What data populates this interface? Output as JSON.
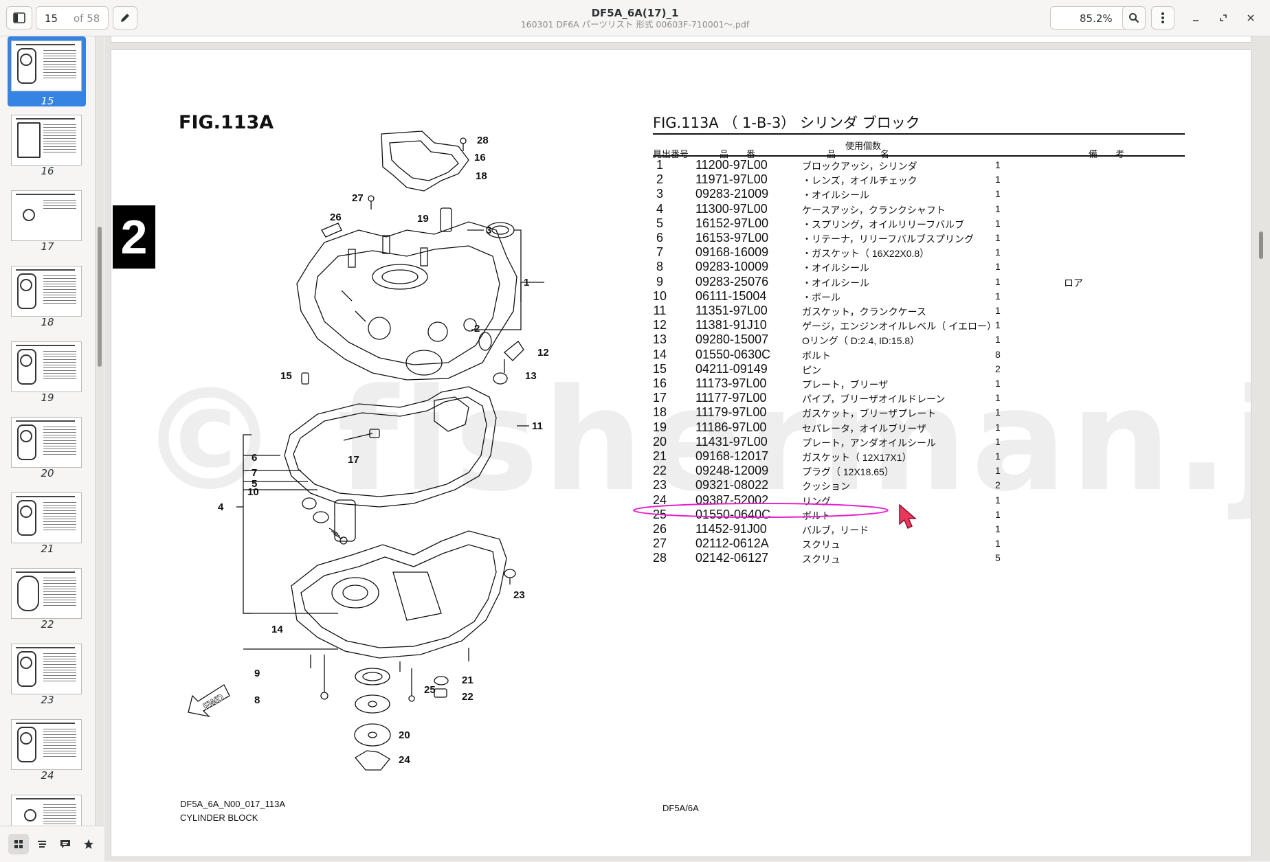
{
  "header": {
    "page_current": "15",
    "page_total": "of 58",
    "title": "DF5A_6A(17)_1",
    "subtitle": "160301 DF6A パーツリスト 形式 00603F-710001～.pdf",
    "zoom": "85.2%",
    "icons": [
      "sidebar-toggle-icon",
      "pencil-icon",
      "search-icon",
      "kebab-menu-icon",
      "minimize-icon",
      "maximize-icon",
      "close-icon"
    ]
  },
  "sidebar": {
    "thumbnails": [
      {
        "label": "15",
        "selected": true
      },
      {
        "label": "16"
      },
      {
        "label": "17"
      },
      {
        "label": "18"
      },
      {
        "label": "19"
      },
      {
        "label": "20"
      },
      {
        "label": "21"
      },
      {
        "label": "22"
      },
      {
        "label": "23"
      },
      {
        "label": "24"
      }
    ],
    "bottom_icons": [
      "thumbnails-icon",
      "outline-icon",
      "annotations-icon",
      "bookmarks-icon"
    ]
  },
  "document": {
    "fig_label": "FIG.113A",
    "section_number": "2",
    "watermark": "© fisherman.jp",
    "table": {
      "title": "FIG.113A （ 1-B-3） シリンダ ブロック",
      "headers": {
        "ref": "見出番号",
        "part_no": "品　　番",
        "name": "品　　　　　名",
        "qty": "使用個数",
        "remarks": "備　　考"
      },
      "rows": [
        {
          "no": "1",
          "part": "11200-97L00",
          "desc": "ブロックアッシ，シリンダ",
          "qty": "1",
          "rem": ""
        },
        {
          "no": "2",
          "part": "11971-97L00",
          "desc": "・レンズ，オイルチェック",
          "qty": "1",
          "rem": ""
        },
        {
          "no": "3",
          "part": "09283-21009",
          "desc": "・オイルシール",
          "qty": "1",
          "rem": ""
        },
        {
          "no": "4",
          "part": "11300-97L00",
          "desc": "ケースアッシ，クランクシャフト",
          "qty": "1",
          "rem": ""
        },
        {
          "no": "5",
          "part": "16152-97L00",
          "desc": "・スプリング，オイルリリーフバルブ",
          "qty": "1",
          "rem": ""
        },
        {
          "no": "6",
          "part": "16153-97L00",
          "desc": "・リテーナ，リリーフバルブスプリング",
          "qty": "1",
          "rem": ""
        },
        {
          "no": "7",
          "part": "09168-16009",
          "desc": "・ガスケット（ 16X22X0.8）",
          "qty": "1",
          "rem": ""
        },
        {
          "no": "8",
          "part": "09283-10009",
          "desc": "・オイルシール",
          "qty": "1",
          "rem": ""
        },
        {
          "no": "9",
          "part": "09283-25076",
          "desc": "・オイルシール",
          "qty": "1",
          "rem": "ロア"
        },
        {
          "no": "10",
          "part": "06111-15004",
          "desc": "・ボール",
          "qty": "1",
          "rem": ""
        },
        {
          "no": "11",
          "part": "11351-97L00",
          "desc": "ガスケット，クランクケース",
          "qty": "1",
          "rem": ""
        },
        {
          "no": "12",
          "part": "11381-91J10",
          "desc": "ゲージ，エンジンオイルレベル（ イエロー）",
          "qty": "1",
          "rem": ""
        },
        {
          "no": "13",
          "part": "09280-15007",
          "desc": "Oリング（ D:2.4, ID:15.8）",
          "qty": "1",
          "rem": ""
        },
        {
          "no": "14",
          "part": "01550-0630C",
          "desc": "ボルト",
          "qty": "8",
          "rem": ""
        },
        {
          "no": "15",
          "part": "04211-09149",
          "desc": "ピン",
          "qty": "2",
          "rem": ""
        },
        {
          "no": "16",
          "part": "11173-97L00",
          "desc": "プレート，ブリーザ",
          "qty": "1",
          "rem": ""
        },
        {
          "no": "17",
          "part": "11177-97L00",
          "desc": "パイプ，ブリーザオイルドレーン",
          "qty": "1",
          "rem": ""
        },
        {
          "no": "18",
          "part": "11179-97L00",
          "desc": "ガスケット，ブリーザプレート",
          "qty": "1",
          "rem": ""
        },
        {
          "no": "19",
          "part": "11186-97L00",
          "desc": "セパレータ，オイルブリーザ",
          "qty": "1",
          "rem": ""
        },
        {
          "no": "20",
          "part": "11431-97L00",
          "desc": "プレート，アンダオイルシール",
          "qty": "1",
          "rem": ""
        },
        {
          "no": "21",
          "part": "09168-12017",
          "desc": "ガスケット（ 12X17X1）",
          "qty": "1",
          "rem": ""
        },
        {
          "no": "22",
          "part": "09248-12009",
          "desc": "プラグ（ 12X18.65）",
          "qty": "1",
          "rem": ""
        },
        {
          "no": "23",
          "part": "09321-08022",
          "desc": "クッション",
          "qty": "2",
          "rem": ""
        },
        {
          "no": "24",
          "part": "09387-52002",
          "desc": "リング",
          "qty": "1",
          "rem": ""
        },
        {
          "no": "25",
          "part": "01550-0640C",
          "desc": "ボルト",
          "qty": "1",
          "rem": ""
        },
        {
          "no": "26",
          "part": "11452-91J00",
          "desc": "バルブ，リード",
          "qty": "1",
          "rem": ""
        },
        {
          "no": "27",
          "part": "02112-0612A",
          "desc": "スクリュ",
          "qty": "1",
          "rem": ""
        },
        {
          "no": "28",
          "part": "02142-06127",
          "desc": "スクリュ",
          "qty": "5",
          "rem": ""
        }
      ],
      "highlighted_row": "21",
      "highlight_color": "#e81fd0"
    },
    "diagram_callouts": [
      "28",
      "16",
      "18",
      "27",
      "26",
      "19",
      "3",
      "1",
      "2",
      "12",
      "15",
      "13",
      "17",
      "11",
      "6",
      "7",
      "5",
      "10",
      "4",
      "23",
      "14",
      "9",
      "25",
      "21",
      "22",
      "8",
      "20",
      "24"
    ],
    "fwd_label": "FWD",
    "footer_left_code": "DF5A_6A_N00_017_113A",
    "footer_left_name": "CYLINDER BLOCK",
    "footer_center": "DF5A/6A"
  },
  "colors": {
    "selection": "#3584e4",
    "cursor": "#e8395a"
  }
}
